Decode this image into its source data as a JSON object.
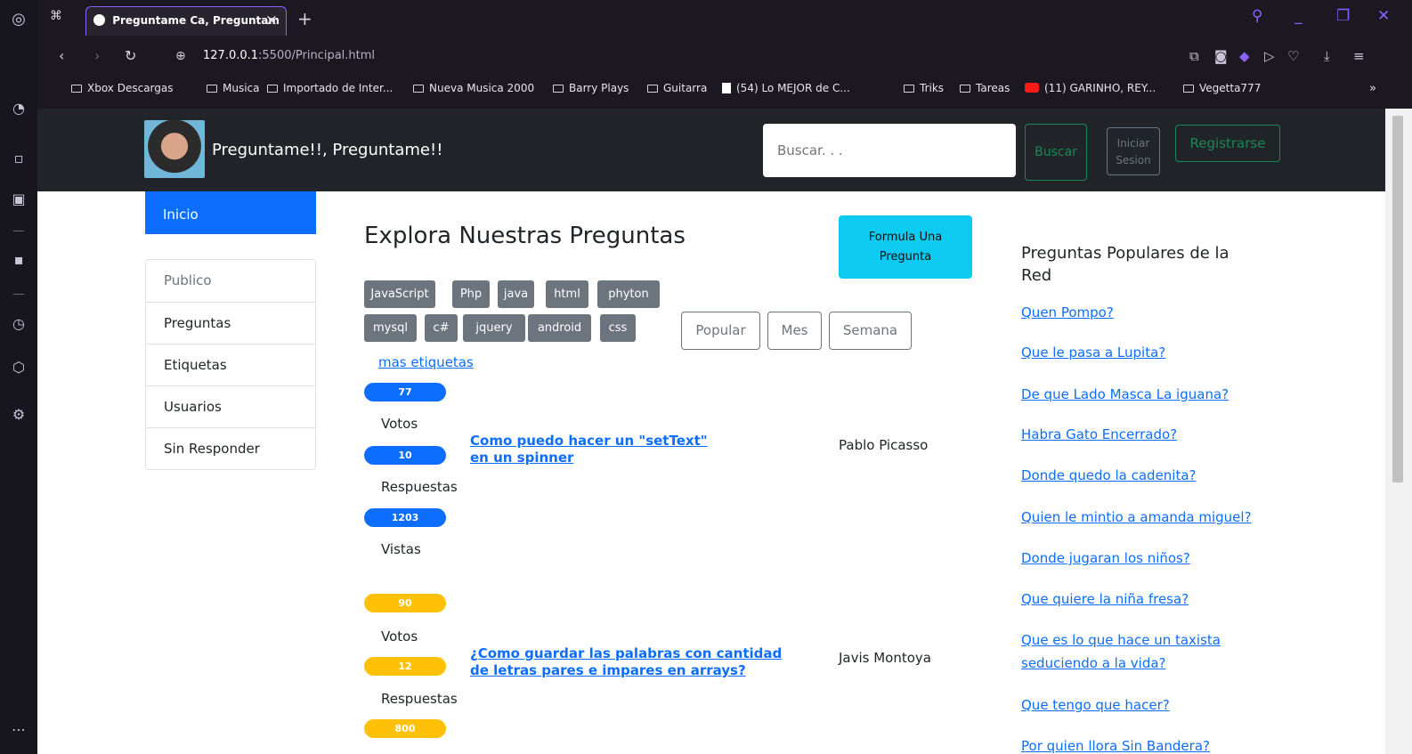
{
  "browser": {
    "tab_title": "Preguntame Ca, Preguntam",
    "url_host": "127.0.0.1",
    "url_rest": ":5500/Principal.html",
    "accent_color": "#8c62ff",
    "bookmarks": [
      {
        "label": "Xbox Descargas",
        "icon": "folder-icon"
      },
      {
        "label": "Musica",
        "icon": "folder-icon"
      },
      {
        "label": "Importado de Inter...",
        "icon": "folder-icon"
      },
      {
        "label": "Nueva Musica 2000",
        "icon": "folder-icon"
      },
      {
        "label": "Barry Plays",
        "icon": "folder-icon"
      },
      {
        "label": "Guitarra",
        "icon": "folder-icon"
      },
      {
        "label": "(54) Lo MEJOR de C...",
        "icon": "document-icon"
      },
      {
        "label": "Triks",
        "icon": "folder-icon"
      },
      {
        "label": "Tareas",
        "icon": "folder-icon"
      },
      {
        "label": "(11) GARINHO, REY...",
        "icon": "youtube-icon"
      },
      {
        "label": "Vegetta777",
        "icon": "folder-icon"
      }
    ]
  },
  "navbar": {
    "brand": "Preguntame!!, Preguntame!!",
    "search_placeholder": "Buscar. . .",
    "buscar_label": "Buscar",
    "iniciar_line1": "Iniciar",
    "iniciar_line2": "Sesion",
    "registrarse_label": "Registrarse"
  },
  "sidebar": {
    "inicio": "Inicio",
    "items": [
      "Publico",
      "Preguntas",
      "Etiquetas",
      "Usuarios",
      "Sin Responder"
    ]
  },
  "main": {
    "title": "Explora Nuestras Preguntas",
    "formula_line1": "Formula Una",
    "formula_line2": "Pregunta",
    "tags": [
      "JavaScript",
      "Php",
      "java",
      "html",
      "phyton",
      "mysql",
      "c#",
      "jquery",
      "android",
      "css"
    ],
    "filters": [
      "Popular",
      "Mes",
      "Semana"
    ],
    "more_tags": "mas etiquetas",
    "stat_labels": {
      "votes": "Votos",
      "answers": "Respuestas",
      "views": "Vistas"
    },
    "questions": [
      {
        "votes": "77",
        "answers": "10",
        "views": "1203",
        "title_line1": "Como puedo hacer un \"setText\"",
        "title_line2": "en un spinner",
        "author": "Pablo Picasso"
      },
      {
        "votes": "90",
        "answers": "12",
        "views": "800",
        "title_line1": "¿Como guardar las palabras con cantidad",
        "title_line2": "de letras pares e impares en arrays?",
        "author": "Javis Montoya"
      }
    ]
  },
  "popular": {
    "heading_line1": "Preguntas Populares de la",
    "heading_line2": "Red",
    "links": [
      "Quen Pompo?",
      "Que le pasa a Lupita?",
      "De que Lado Masca La iguana?",
      "Habra Gato Encerrado?",
      "Donde quedo la cadenita?",
      "Quien le mintio a amanda miguel?",
      "Donde jugaran los niños?",
      "Que quiere la niña fresa?",
      "Que es lo que hace un taxista",
      "seduciendo a la vida?",
      "Que tengo que hacer?",
      "Por quien llora Sin Bandera?"
    ]
  },
  "colors": {
    "primary": "#0d6efd",
    "success": "#198754",
    "info": "#0dcaf0",
    "warning": "#ffc107",
    "secondary": "#6c757d",
    "dark": "#212529"
  }
}
